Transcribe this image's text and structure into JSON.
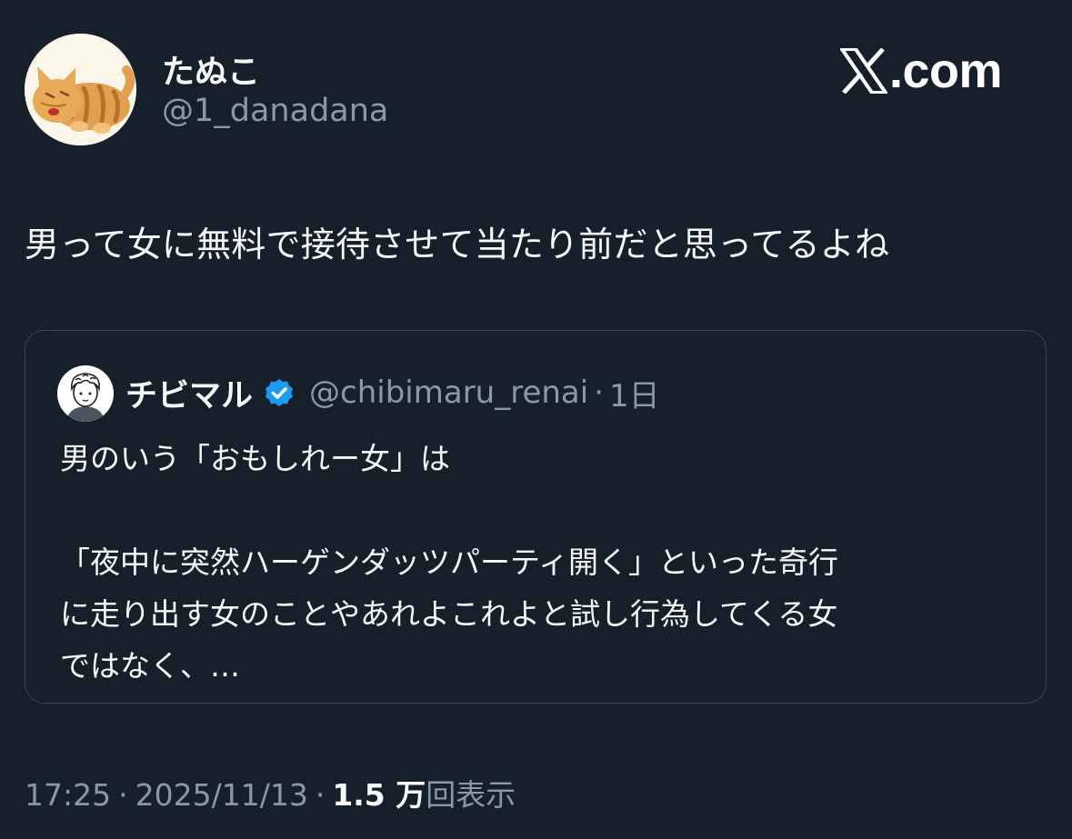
{
  "author": {
    "name": "たぬこ",
    "handle": "@1_danadana"
  },
  "brand": {
    "domain": ".com"
  },
  "tweet": {
    "text": "男って女に無料で接待させて当たり前だと思ってるよね"
  },
  "quote": {
    "name": "チビマル",
    "handle": "@chibimaru_renai",
    "separator": "·",
    "time": "1日",
    "lines": [
      "男のいう「おもしれー女」は",
      "「夜中に突然ハーゲンダッツパーティ開く」といった奇行",
      "に走り出す女のことやあれよこれよと試し行為してくる女",
      "ではなく、…"
    ]
  },
  "meta": {
    "time": "17:25",
    "sep1": "·",
    "date": "2025/11/13",
    "sep2": "·",
    "views": "1.5 万",
    "views_label": "回表示"
  },
  "colors": {
    "background": "#15202b",
    "text_primary": "#f7f9f9",
    "text_secondary": "#8b98a5",
    "border": "#38444d",
    "verified": "#1d9bf0"
  },
  "icons": {
    "author_avatar": "cat-avatar",
    "quote_avatar": "cartoon-person-avatar",
    "verified": "verified-badge-icon",
    "brand": "x-logo-icon"
  }
}
